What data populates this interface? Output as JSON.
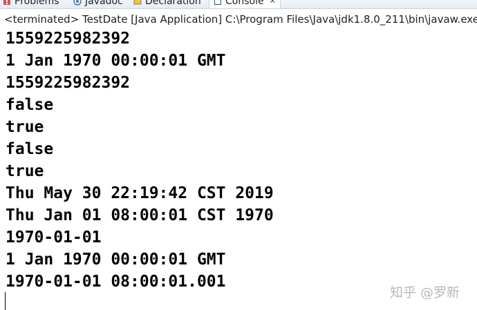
{
  "tabs": [
    {
      "label": "Problems",
      "icon": "problems-icon",
      "active": false
    },
    {
      "label": "Javadoc",
      "icon": "javadoc-icon",
      "active": false
    },
    {
      "label": "Declaration",
      "icon": "declaration-icon",
      "active": false
    },
    {
      "label": "Console",
      "icon": "console-icon",
      "active": true
    }
  ],
  "console": {
    "status": "<terminated> TestDate [Java Application] C:\\Program Files\\Java\\jdk1.8.0_211\\bin\\javaw.exe (20",
    "lines": [
      "1559225982392",
      "1 Jan 1970 00:00:01 GMT",
      "1559225982392",
      "false",
      "true",
      "false",
      "true",
      "Thu May 30 22:19:42 CST 2019",
      "Thu Jan 01 08:00:01 CST 1970",
      "1970-01-01",
      "1 Jan 1970 00:00:01 GMT",
      "1970-01-01 08:00:01.001"
    ]
  },
  "watermark": "知乎 @罗新",
  "colors": {
    "background": "#ffffff",
    "text": "#000000",
    "tabbar": "#e6ecf4",
    "watermark": "#b8b8b8"
  }
}
